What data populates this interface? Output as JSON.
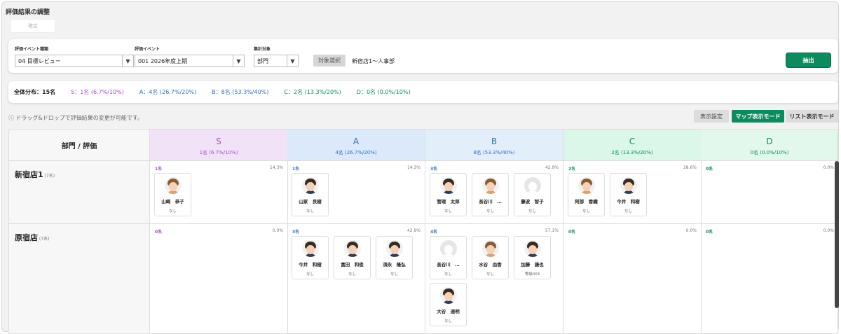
{
  "page": {
    "title": "評価結果の調整",
    "confirm_label": "確定"
  },
  "filters": {
    "event_type": {
      "label": "評価イベント種類",
      "value": "04 目標レビュー"
    },
    "event": {
      "label": "評価イベント",
      "value": "001 2026年度上期"
    },
    "target": {
      "label": "集計対象",
      "value": "部門"
    },
    "select_button": "対象選択",
    "selected_text": "新宿店1〜人事部",
    "extract_button": "抽出"
  },
  "distribution": {
    "total": "全体分布：15名",
    "S": "S：1名 (6.7%/10%)",
    "A": "A：4名 (26.7%/20%)",
    "B": "B：8名 (53.3%/40%)",
    "C": "C：2名 (13.3%/20%)",
    "D": "D：0名 (0.0%/10%)"
  },
  "hint": "ⓘ ドラッグ&ドロップで評価結果の変更が可能です。",
  "view": {
    "settings": "表示設定",
    "map_mode": "マップ表示モード",
    "list_mode": "リスト表示モード"
  },
  "colors": {
    "S": "#a34fc4",
    "A": "#2f6fc4",
    "B": "#2f6fc4",
    "C": "#0e8a5f",
    "D": "#0e8a5f",
    "accent": "#0e8a5f"
  },
  "grid": {
    "corner": "部門 / 評価",
    "columns": [
      {
        "grade": "S",
        "count": "1名 (6.7%/10%)"
      },
      {
        "grade": "A",
        "count": "4名 (26.7%/20%)"
      },
      {
        "grade": "B",
        "count": "8名 (53.3%/40%)"
      },
      {
        "grade": "C",
        "count": "2名 (13.3%/20%)"
      },
      {
        "grade": "D",
        "count": "0名 (0.0%/10%)"
      }
    ],
    "rows": [
      {
        "name": "新宿店1",
        "sub": "(7名)",
        "cells": [
          {
            "count": "1名",
            "pct": "14.3%",
            "employees": [
              {
                "name": "山崎　恭子",
                "status": "なし",
                "avatar": "woman"
              }
            ]
          },
          {
            "count": "1名",
            "pct": "14.3%",
            "employees": [
              {
                "name": "山家　良樹",
                "status": "なし",
                "avatar": "man"
              }
            ]
          },
          {
            "count": "3名",
            "pct": "42.9%",
            "employees": [
              {
                "name": "管理　太郎",
                "status": "なし",
                "avatar": "man"
              },
              {
                "name": "長谷川　…",
                "status": "なし",
                "avatar": "woman"
              },
              {
                "name": "藤波　智子",
                "status": "なし",
                "avatar": "placeholder"
              }
            ]
          },
          {
            "count": "2名",
            "pct": "28.6%",
            "employees": [
              {
                "name": "阿部　香織",
                "status": "なし",
                "avatar": "woman"
              },
              {
                "name": "今井　和樹",
                "status": "なし",
                "avatar": "man"
              }
            ]
          },
          {
            "count": "0名",
            "pct": "0.0%",
            "employees": []
          }
        ]
      },
      {
        "name": "原宿店",
        "sub": "(7名)",
        "cells": [
          {
            "count": "0名",
            "pct": "0.0%",
            "employees": []
          },
          {
            "count": "3名",
            "pct": "42.9%",
            "employees": [
              {
                "name": "今井　和樹",
                "status": "なし",
                "avatar": "man"
              },
              {
                "name": "富田　和俊",
                "status": "なし",
                "avatar": "man"
              },
              {
                "name": "須永　隆弘",
                "status": "なし",
                "avatar": "man"
              }
            ]
          },
          {
            "count": "4名",
            "pct": "57.1%",
            "employees": [
              {
                "name": "長谷川　…",
                "status": "なし",
                "avatar": "placeholder"
              },
              {
                "name": "水谷　由香",
                "status": "なし",
                "avatar": "woman"
              },
              {
                "name": "加藤　謙也",
                "status": "等級004",
                "avatar": "man"
              },
              {
                "name": "大谷　達明",
                "status": "なし",
                "avatar": "man"
              }
            ]
          },
          {
            "count": "0名",
            "pct": "0.0%",
            "employees": []
          },
          {
            "count": "0名",
            "pct": "0.0%",
            "employees": []
          }
        ]
      }
    ]
  }
}
